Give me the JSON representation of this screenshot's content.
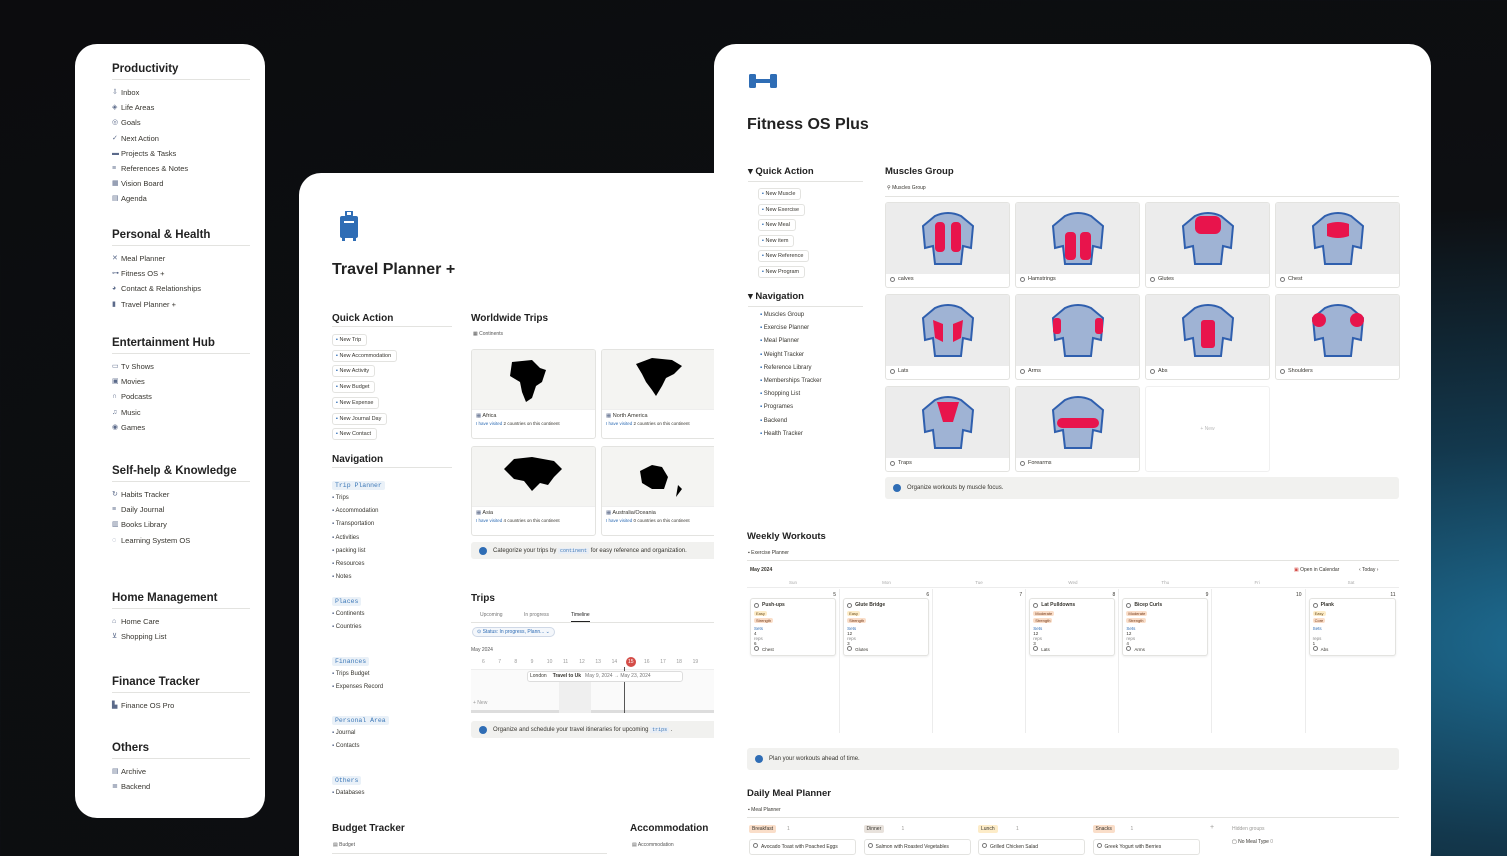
{
  "sidebar": {
    "sections": [
      {
        "title": "Productivity",
        "items": [
          {
            "label": "Inbox",
            "icon": "inbox-icon"
          },
          {
            "label": "Life Areas",
            "icon": "layers-icon"
          },
          {
            "label": "Goals",
            "icon": "target-icon"
          },
          {
            "label": "Next Action",
            "icon": "check-circle-icon"
          },
          {
            "label": "Projects & Tasks",
            "icon": "folder-icon"
          },
          {
            "label": "References & Notes",
            "icon": "list-pen-icon"
          },
          {
            "label": "Vision Board",
            "icon": "grid-icon"
          },
          {
            "label": "Agenda",
            "icon": "calendar-icon"
          }
        ]
      },
      {
        "title": "Personal & Health",
        "items": [
          {
            "label": "Meal Planner",
            "icon": "utensils-icon"
          },
          {
            "label": "Fitness OS +",
            "icon": "dumbbell-icon"
          },
          {
            "label": "Contact & Relationships",
            "icon": "people-icon"
          },
          {
            "label": "Travel Planner +",
            "icon": "luggage-icon"
          }
        ]
      },
      {
        "title": "Entertainment Hub",
        "items": [
          {
            "label": "Tv Shows",
            "icon": "tv-icon"
          },
          {
            "label": "Movies",
            "icon": "film-icon"
          },
          {
            "label": "Podcasts",
            "icon": "headphones-icon"
          },
          {
            "label": "Music",
            "icon": "music-icon"
          },
          {
            "label": "Games",
            "icon": "gamepad-icon"
          }
        ]
      },
      {
        "title": "Self-help & Knowledge",
        "items": [
          {
            "label": "Habits Tracker",
            "icon": "repeat-icon"
          },
          {
            "label": "Daily Journal",
            "icon": "list-pen-icon"
          },
          {
            "label": "Books Library",
            "icon": "book-icon"
          },
          {
            "label": "Learning System OS",
            "icon": "bulb-icon"
          }
        ]
      },
      {
        "title": "Home Management",
        "items": [
          {
            "label": "Home Care",
            "icon": "home-icon"
          },
          {
            "label": "Shopping List",
            "icon": "cart-icon"
          }
        ]
      },
      {
        "title": "Finance Tracker",
        "items": [
          {
            "label": "Finance OS Pro",
            "icon": "bank-icon"
          }
        ]
      },
      {
        "title": "Others",
        "items": [
          {
            "label": "Archive",
            "icon": "archive-icon"
          },
          {
            "label": "Backend",
            "icon": "database-icon"
          }
        ]
      }
    ]
  },
  "travel": {
    "title": "Travel Planner +",
    "quick_action_title": "Quick Action",
    "quick_actions": [
      "New Trip",
      "New Accommodation",
      "New Activity",
      "New Budget",
      "New Expense",
      "New Journal Day",
      "New Contact"
    ],
    "navigation_title": "Navigation",
    "nav_groups": [
      {
        "tag": "Trip Planner",
        "items": [
          "Trips",
          "Accommodation",
          "Transportation",
          "Activities",
          "packing list",
          "Resources",
          "Notes"
        ]
      },
      {
        "tag": "Places",
        "items": [
          "Continents",
          "Countries"
        ]
      },
      {
        "tag": "Finances",
        "items": [
          "Trips Budget",
          "Expenses Record"
        ]
      },
      {
        "tag": "Personal Area",
        "items": [
          "Journal",
          "Contacts"
        ]
      },
      {
        "tag": "Others",
        "items": [
          "Databases"
        ]
      }
    ],
    "worldwide_title": "Worldwide Trips",
    "worldwide_sub": "Continents",
    "continents": [
      {
        "name": "Africa",
        "count": "2"
      },
      {
        "name": "North America",
        "count": "2"
      },
      {
        "name": "Asia",
        "count": "4"
      },
      {
        "name": "Australia/Oceania",
        "count": "0"
      }
    ],
    "visited_prefix": "I have visited",
    "visited_suffix": "countries on this continent",
    "categorize_pre": "Categorize your trips by",
    "categorize_code": "continent",
    "categorize_post": "for easy reference and organization.",
    "trips_title": "Trips",
    "trips_tabs": [
      "Upcoming",
      "In progress",
      "Timeline"
    ],
    "trips_filter": "Status: In progress, Plann...",
    "timeline_month": "May 2024",
    "timeline_days": [
      "6",
      "7",
      "8",
      "9",
      "10",
      "11",
      "12",
      "13",
      "14",
      "15",
      "16",
      "17",
      "18",
      "19"
    ],
    "timeline_today": "15",
    "timeline_london": "London",
    "timeline_trip": "Travel to Uk",
    "timeline_range": "May 9, 2024 → May 23, 2024",
    "timeline_new": "+ New",
    "organize_pre": "Organize and schedule your travel itineraries for upcoming",
    "organize_code": "trips",
    "organize_post": ".",
    "budget_title": "Budget Tracker",
    "budget_sub": "Budget",
    "accommodation_title": "Accommodation",
    "accommodation_sub": "Accommodation"
  },
  "fitness": {
    "title": "Fitness OS Plus",
    "quick_action_title": "Quick Action",
    "quick_actions": [
      "New Muscle",
      "New Exercise",
      "New Meal",
      "New item",
      "New Reference",
      "New Program"
    ],
    "navigation_title": "Navigation",
    "nav_items": [
      "Muscles Group",
      "Exercise Planner",
      "Meal Planner",
      "Weight Tracker",
      "Reference Library",
      "Memberships Tracker",
      "Shopping List",
      "Programes",
      "Backend",
      "Health Tracker"
    ],
    "muscles_title": "Muscles Group",
    "muscles_sub": "Muscles Group",
    "muscles": [
      "calves",
      "Hamstrings",
      "Glutes",
      "Chest",
      "Lats",
      "Arms",
      "Abs",
      "Shoulders",
      "Traps",
      "Forearms"
    ],
    "muscles_new": "+ New",
    "muscles_callout": "Organize workouts by muscle focus.",
    "weekly_title": "Weekly Workouts",
    "weekly_sub": "Exercise Planner",
    "cal_month": "May 2024",
    "cal_open": "Open in Calendar",
    "cal_today": "Today",
    "weekdays": [
      "Sun",
      "Mon",
      "Tue",
      "Wed",
      "Thu",
      "Fri",
      "Sat"
    ],
    "dates": [
      "5",
      "6",
      "7",
      "8",
      "9",
      "10",
      "11"
    ],
    "events": [
      {
        "day": 0,
        "name": "Push-ups",
        "level": "Easy",
        "type": "Strength",
        "sets": "4",
        "reps": "6",
        "muscle": "Chest"
      },
      {
        "day": 1,
        "name": "Glute Bridge",
        "level": "Easy",
        "type": "Strength",
        "sets": "12",
        "reps": "3",
        "muscle": "Glutes"
      },
      {
        "day": 3,
        "name": "Lat Pulldowns",
        "level": "Moderate",
        "type": "Strength",
        "sets": "12",
        "reps": "3",
        "muscle": "Lats"
      },
      {
        "day": 4,
        "name": "Bicep Curls",
        "level": "Moderate",
        "type": "Strength",
        "sets": "12",
        "reps": "4",
        "muscle": "Arms"
      },
      {
        "day": 6,
        "name": "Plank",
        "level": "Easy",
        "type": "Core",
        "sets": "",
        "reps": "1",
        "muscle": "Abs"
      }
    ],
    "sets_label": "Sets",
    "reps_label": "reps",
    "weekly_callout": "Plan your workouts ahead of time.",
    "meal_title": "Daily Meal Planner",
    "meal_sub": "Meal Planner",
    "meal_groups": [
      {
        "name": "Breakfast",
        "count": "1",
        "item": "Avocado Toast with Poached Eggs",
        "color": "#fadec9"
      },
      {
        "name": "Dinner",
        "count": "1",
        "item": "Salmon with Roasted Vegetables",
        "color": "#e8e2dc"
      },
      {
        "name": "Lunch",
        "count": "1",
        "item": "Grilled Chicken Salad",
        "color": "#fdecc8"
      },
      {
        "name": "Snacks",
        "count": "1",
        "item": "Greek Yogurt with Berries",
        "color": "#fadec9"
      }
    ],
    "hidden_groups": "Hidden groups",
    "no_meal_type": "No Meal Type",
    "no_meal_count": "0"
  }
}
